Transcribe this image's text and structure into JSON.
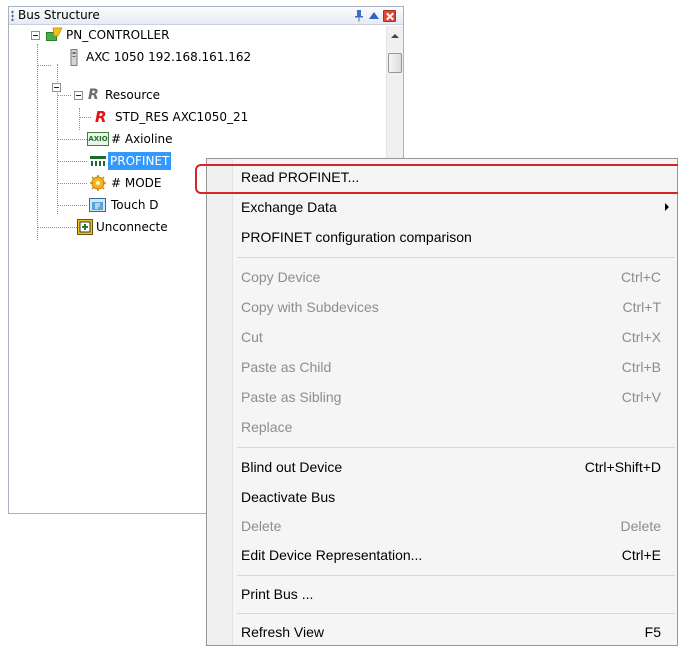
{
  "panel": {
    "title": "Bus Structure",
    "icons": {
      "pin": "pin-icon",
      "up": "caret-up-icon",
      "close": "close-icon"
    }
  },
  "tree": {
    "controller": "PN_CONTROLLER",
    "device": "AXC 1050 192.168.161.162",
    "resource": "Resource",
    "resource_letter": "R",
    "std_res": "STD_RES AXC1050_21",
    "axioline": "# Axioline",
    "axioline_badge": "AXIO",
    "profinet": "PROFINET",
    "modbus": "# MODE",
    "touch": "Touch D",
    "unconnected": "Unconnecte"
  },
  "menu": {
    "items": [
      {
        "label": "Read PROFINET...",
        "shortcut": "",
        "disabled": false,
        "submenu": false
      },
      {
        "label": "Exchange Data",
        "shortcut": "",
        "disabled": false,
        "submenu": true
      },
      {
        "label": "PROFINET configuration comparison",
        "shortcut": "",
        "disabled": false,
        "submenu": false
      },
      {
        "label": "Copy Device",
        "shortcut": "Ctrl+C",
        "disabled": true,
        "submenu": false
      },
      {
        "label": "Copy with Subdevices",
        "shortcut": "Ctrl+T",
        "disabled": true,
        "submenu": false
      },
      {
        "label": "Cut",
        "shortcut": "Ctrl+X",
        "disabled": true,
        "submenu": false
      },
      {
        "label": "Paste as Child",
        "shortcut": "Ctrl+B",
        "disabled": true,
        "submenu": false
      },
      {
        "label": "Paste as Sibling",
        "shortcut": "Ctrl+V",
        "disabled": true,
        "submenu": false
      },
      {
        "label": "Replace",
        "shortcut": "",
        "disabled": true,
        "submenu": false
      },
      {
        "label": "Blind out Device",
        "shortcut": "Ctrl+Shift+D",
        "disabled": false,
        "submenu": false
      },
      {
        "label": "Deactivate Bus",
        "shortcut": "",
        "disabled": false,
        "submenu": false
      },
      {
        "label": "Delete",
        "shortcut": "Delete",
        "disabled": true,
        "submenu": false
      },
      {
        "label": "Edit Device Representation...",
        "shortcut": "Ctrl+E",
        "disabled": false,
        "submenu": false
      },
      {
        "label": "Print Bus ...",
        "shortcut": "",
        "disabled": false,
        "submenu": false
      },
      {
        "label": "Refresh View",
        "shortcut": "F5",
        "disabled": false,
        "submenu": false
      }
    ]
  },
  "colors": {
    "selection": "#3399ff",
    "highlight_ring": "#d8232a",
    "disabled_text": "#8d8d8d"
  }
}
